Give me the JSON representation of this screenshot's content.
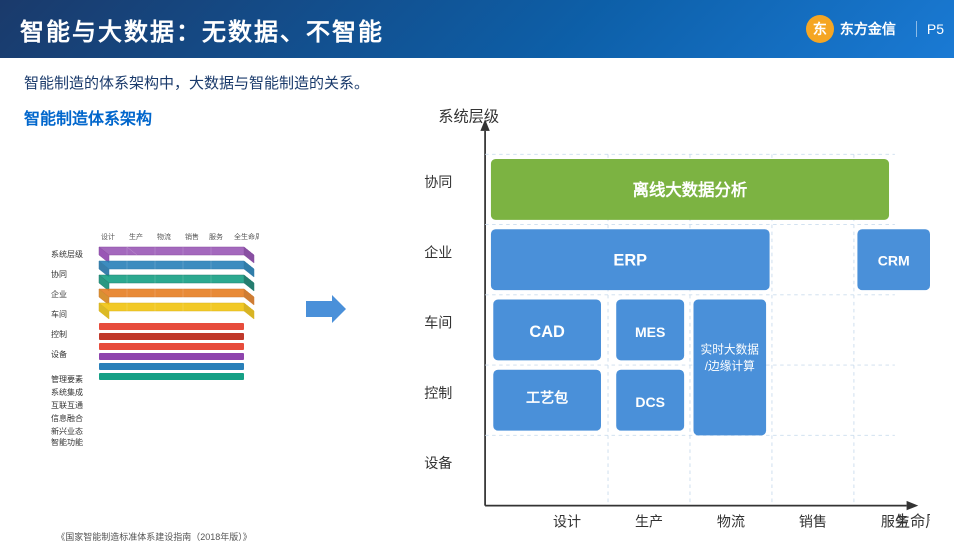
{
  "header": {
    "title": "智能与大数据：无数据、不智能",
    "logo_text": "东方金信",
    "page": "P5"
  },
  "subtitle": "智能制造的体系架构中，大数据与智能制造的关系。",
  "left": {
    "title": "智能制造体系架构",
    "caption": "《国家智能制造标准体系建设指南（2018年版）》"
  },
  "chart": {
    "y_axis_label": "系统层级",
    "x_axis_label": "生命周期",
    "y_labels": [
      "协同",
      "企业",
      "车间",
      "控制",
      "设备"
    ],
    "x_labels": [
      "设计",
      "生产",
      "物流",
      "销售",
      "服务"
    ],
    "boxes": [
      {
        "label": "离线大数据分析",
        "row": 0,
        "col_start": 0,
        "col_end": 4,
        "color": "#7cb342",
        "text_color": "#fff"
      },
      {
        "label": "ERP",
        "row": 1,
        "col_start": 0,
        "col_end": 3,
        "color": "#4a90d9",
        "text_color": "#fff"
      },
      {
        "label": "CRM",
        "row": 1,
        "col_start": 3,
        "col_end": 4,
        "color": "#4a90d9",
        "text_color": "#fff"
      },
      {
        "label": "CAD",
        "row": 2,
        "col_start": 0,
        "col_end": 0,
        "color": "#4a90d9",
        "text_color": "#fff"
      },
      {
        "label": "MES",
        "row": 2,
        "col_start": 1,
        "col_end": 1,
        "color": "#4a90d9",
        "text_color": "#fff"
      },
      {
        "label": "实时大数据/边缘计算",
        "row": 2,
        "col_start": 2,
        "col_end": 2,
        "color": "#4a90d9",
        "text_color": "#fff"
      },
      {
        "label": "工艺包",
        "row": 3,
        "col_start": 0,
        "col_end": 0,
        "color": "#4a90d9",
        "text_color": "#fff"
      },
      {
        "label": "DCS",
        "row": 3,
        "col_start": 1,
        "col_end": 1,
        "color": "#4a90d9",
        "text_color": "#fff"
      }
    ]
  }
}
